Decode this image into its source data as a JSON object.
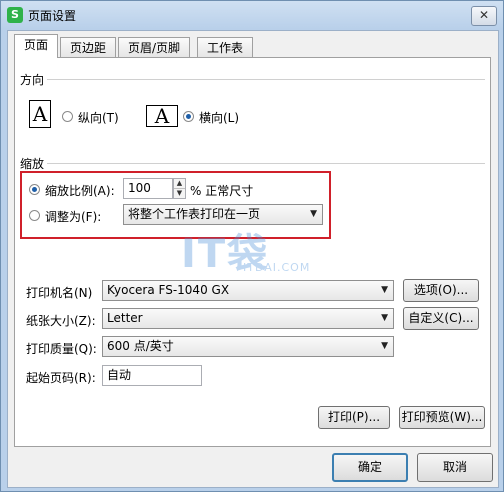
{
  "window": {
    "title": "页面设置",
    "app_icon_letter": "S",
    "close_symbol": "✕"
  },
  "tabs": [
    {
      "label": "页面",
      "active": true
    },
    {
      "label": "页边距",
      "active": false
    },
    {
      "label": "页眉/页脚",
      "active": false
    },
    {
      "label": "工作表",
      "active": false
    }
  ],
  "orientation": {
    "section_label": "方向",
    "portrait_label": "纵向(T)",
    "landscape_label": "横向(L)",
    "selected": "landscape",
    "page_glyph": "A"
  },
  "scaling": {
    "section_label": "缩放",
    "scale_label": "缩放比例(A):",
    "scale_value": "100",
    "scale_suffix": "% 正常尺寸",
    "fit_label": "调整为(F):",
    "fit_option": "将整个工作表打印在一页",
    "selected": "scale"
  },
  "printer": {
    "label": "打印机名(N)",
    "value": "Kyocera FS-1040 GX",
    "options_button": "选项(O)..."
  },
  "paper": {
    "label": "纸张大小(Z):",
    "value": "Letter",
    "custom_button": "自定义(C)..."
  },
  "quality": {
    "label": "打印质量(Q):",
    "value": "600 点/英寸"
  },
  "start_page": {
    "label": "起始页码(R):",
    "value": "自动"
  },
  "actions": {
    "print": "打印(P)...",
    "preview": "打印预览(W)...",
    "ok": "确定",
    "cancel": "取消"
  },
  "watermark": {
    "logo": "IT袋",
    "url": "ITDAI.COM"
  },
  "colors": {
    "highlight_border": "#d0202a",
    "accent": "#1f5fa8",
    "app_icon": "#2fb24a"
  }
}
